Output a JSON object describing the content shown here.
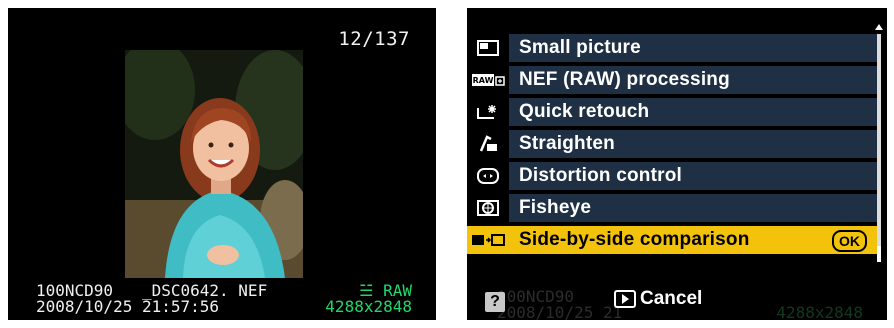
{
  "left_screen": {
    "frame_counter": "12/137",
    "folder": "100NCD90",
    "filename": "_DSC0642. NEF",
    "date": "2008/10/25",
    "time": "21:57:56",
    "quality": "RAW",
    "image_size": "4288x2848",
    "colors": {
      "info_green": "#20d86a"
    }
  },
  "right_screen": {
    "menu_items": [
      {
        "icon": "small-picture-icon",
        "label": "Small picture"
      },
      {
        "icon": "nef-raw-processing-icon",
        "label": "NEF (RAW) processing"
      },
      {
        "icon": "quick-retouch-icon",
        "label": "Quick retouch"
      },
      {
        "icon": "straighten-icon",
        "label": "Straighten"
      },
      {
        "icon": "distortion-control-icon",
        "label": "Distortion control"
      },
      {
        "icon": "fisheye-icon",
        "label": "Fisheye"
      },
      {
        "icon": "side-by-side-icon",
        "label": "Side-by-side comparison",
        "selected": true
      }
    ],
    "ok_label": "OK",
    "help_label": "?",
    "cancel_label": "Cancel",
    "ghost": {
      "folder": "100NCD90",
      "date": "2008/10/25",
      "time_partial": "21",
      "size": "4288x2848"
    },
    "colors": {
      "menu_row": "#1f2f44",
      "selected_row": "#f3c20b"
    }
  }
}
